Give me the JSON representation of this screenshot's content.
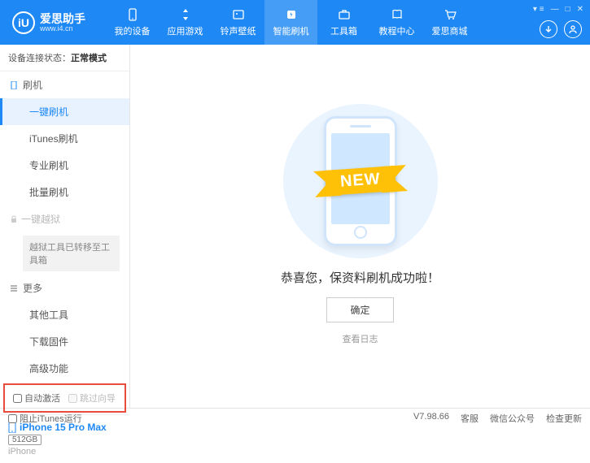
{
  "header": {
    "logo_initial": "iU",
    "logo_title": "爱思助手",
    "logo_sub": "www.i4.cn",
    "nav": [
      {
        "label": "我的设备"
      },
      {
        "label": "应用游戏"
      },
      {
        "label": "铃声壁纸"
      },
      {
        "label": "智能刷机"
      },
      {
        "label": "工具箱"
      },
      {
        "label": "教程中心"
      },
      {
        "label": "爱思商城"
      }
    ]
  },
  "sidebar": {
    "conn_prefix": "设备连接状态：",
    "conn_status": "正常模式",
    "section_flash": "刷机",
    "items_flash": [
      {
        "label": "一键刷机",
        "active": true
      },
      {
        "label": "iTunes刷机"
      },
      {
        "label": "专业刷机"
      },
      {
        "label": "批量刷机"
      }
    ],
    "section_jailbreak": "一键越狱",
    "jailbreak_notice": "越狱工具已转移至工具箱",
    "section_more": "更多",
    "items_more": [
      {
        "label": "其他工具"
      },
      {
        "label": "下载固件"
      },
      {
        "label": "高级功能"
      }
    ],
    "checkbox1": "自动激活",
    "checkbox2": "跳过向导",
    "device_name": "iPhone 15 Pro Max",
    "device_storage": "512GB",
    "device_type": "iPhone"
  },
  "main": {
    "ribbon": "NEW",
    "success": "恭喜您，保资料刷机成功啦！",
    "confirm": "确定",
    "view_log": "查看日志"
  },
  "footer": {
    "block_itunes": "阻止iTunes运行",
    "version": "V7.98.66",
    "links": [
      "客服",
      "微信公众号",
      "检查更新"
    ]
  }
}
